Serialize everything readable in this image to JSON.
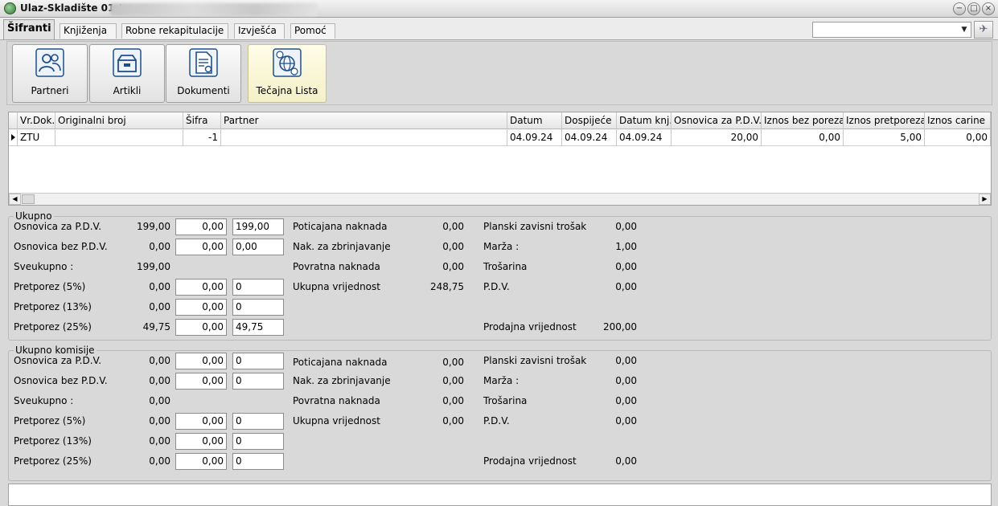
{
  "window": {
    "title": "Ulaz-Skladište 01 /",
    "controls": [
      "minimize-icon",
      "maximize-icon",
      "close-icon"
    ]
  },
  "tabs": [
    {
      "label": "Šifranti",
      "active": true
    },
    {
      "label": "Knjiženja"
    },
    {
      "label": "Robne rekapitulacije"
    },
    {
      "label": "Izvješća"
    },
    {
      "label": "Pomoć"
    }
  ],
  "toolbar": {
    "combo_value": "",
    "pin_icon": "pin-icon",
    "buttons": [
      {
        "label": "Partneri",
        "icon": "partners-icon"
      },
      {
        "label": "Artikli",
        "icon": "articles-icon"
      },
      {
        "label": "Dokumenti",
        "icon": "documents-icon"
      },
      {
        "label": "Tečajna Lista",
        "icon": "exchange-rate-icon"
      }
    ]
  },
  "grid": {
    "columns": [
      "Vr.Dok.",
      "Originalni broj",
      "Šifra",
      "Partner",
      "Datum",
      "Dospijeće",
      "Datum knj.",
      "Osnovica za P.D.V.",
      "Iznos bez poreza",
      "Iznos pretporeza",
      "Iznos carine"
    ],
    "rows": [
      [
        "ZTU",
        "",
        "-1",
        "",
        "04.09.24",
        "04.09.24",
        "04.09.24",
        "20,00",
        "0,00",
        "5,00",
        "0,00"
      ]
    ]
  },
  "ukupno": {
    "title": "Ukupno",
    "rows": [
      {
        "label": "Osnovica za P.D.V.",
        "value": "199,00",
        "input1": "0,00",
        "input2": "199,00"
      },
      {
        "label": "Osnovica bez P.D.V.",
        "value": "0,00",
        "input1": "0,00",
        "input2": "0,00"
      },
      {
        "label": "Sveukupno :",
        "value": "199,00"
      },
      {
        "label": "Pretporez (5%)",
        "value": "0,00",
        "input1": "0,00",
        "input2": "0"
      },
      {
        "label": "Pretporez (13%)",
        "value": "0,00",
        "input1": "0,00",
        "input2": "0"
      },
      {
        "label": "Pretporez (25%)",
        "value": "49,75",
        "input1": "0,00",
        "input2": "49,75"
      }
    ],
    "middle": [
      {
        "label": "Poticajana naknada",
        "value": "0,00"
      },
      {
        "label": "Nak. za zbrinjavanje",
        "value": "0,00"
      },
      {
        "label": "Povratna naknada",
        "value": "0,00"
      },
      {
        "label": "Ukupna vrijednost",
        "value": "248,75"
      }
    ],
    "right": [
      {
        "label": "Planski zavisni trošak",
        "value": "0,00"
      },
      {
        "label": "Marža :",
        "value": "1,00"
      },
      {
        "label": "Trošarina",
        "value": "0,00"
      },
      {
        "label": "P.D.V.",
        "value": "0,00"
      },
      {
        "label": "Prodajna vrijednost",
        "value": "200,00"
      }
    ]
  },
  "komisije": {
    "title": "Ukupno komisije",
    "rows": [
      {
        "label": "Osnovica za P.D.V.",
        "value": "0,00",
        "input1": "0,00",
        "input2": "0"
      },
      {
        "label": "Osnovica bez P.D.V.",
        "value": "0,00",
        "input1": "0,00",
        "input2": "0"
      },
      {
        "label": "Sveukupno :",
        "value": "0,00"
      },
      {
        "label": "Pretporez (5%)",
        "value": "0,00",
        "input1": "0,00",
        "input2": "0"
      },
      {
        "label": "Pretporez (13%)",
        "value": "0,00",
        "input1": "0,00",
        "input2": "0"
      },
      {
        "label": "Pretporez (25%)",
        "value": "0,00",
        "input1": "0,00",
        "input2": "0"
      }
    ],
    "middle": [
      {
        "label": "Poticajana naknada",
        "value": "0,00"
      },
      {
        "label": "Nak. za zbrinjavanje",
        "value": "0,00"
      },
      {
        "label": "Povratna naknada",
        "value": "0,00"
      },
      {
        "label": "Ukupna vrijednost",
        "value": "0,00"
      }
    ],
    "right": [
      {
        "label": "Planski zavisni trošak",
        "value": "0,00"
      },
      {
        "label": "Marža :",
        "value": "0,00"
      },
      {
        "label": "Trošarina",
        "value": "0,00"
      },
      {
        "label": "P.D.V.",
        "value": "0,00"
      },
      {
        "label": "Prodajna vrijednost",
        "value": "0,00"
      }
    ]
  }
}
